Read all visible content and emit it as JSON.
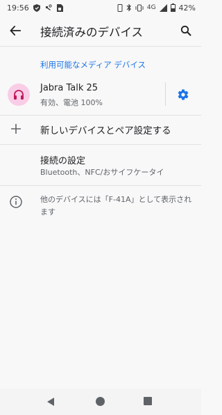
{
  "status_bar": {
    "time": "19:56",
    "network": "4G",
    "battery": "42%",
    "icons": [
      "shield-icon",
      "voicemail-icon",
      "phone-missed-icon",
      "sim-save-icon",
      "vibrate-icon",
      "bluetooth-icon",
      "vibrate-mode-icon",
      "signal-icon",
      "battery-icon"
    ]
  },
  "app_bar": {
    "title": "接続済みのデバイス",
    "back_icon": "arrow-back-icon",
    "search_icon": "search-icon"
  },
  "section": {
    "header": "利用可能なメディア デバイス"
  },
  "device": {
    "name": "Jabra Talk 25",
    "status": "有効、電池 100%",
    "icon": "headset-icon",
    "settings_icon": "gear-icon",
    "colors": {
      "avatar_bg": "#f9cde6",
      "avatar_fg": "#c2185b",
      "accent": "#1a73e8"
    }
  },
  "pair": {
    "label": "新しいデバイスとペア設定する",
    "icon": "plus-icon"
  },
  "prefs": {
    "title": "接続の設定",
    "summary": "Bluetooth、NFC/おサイフケータイ"
  },
  "info": {
    "text": "他のデバイスには「F-41A」として表示されます",
    "icon": "info-icon"
  },
  "nav": {
    "icons": [
      "nav-back-icon",
      "nav-home-icon",
      "nav-recents-icon"
    ]
  }
}
